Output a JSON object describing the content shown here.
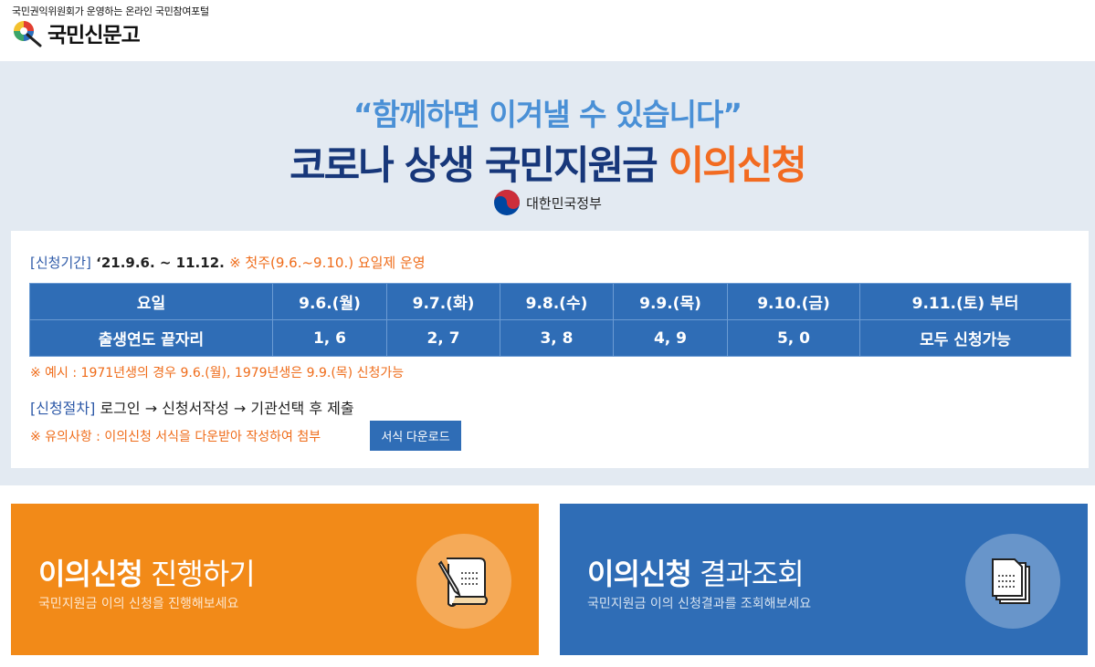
{
  "header": {
    "tagline": "국민권익위원회가 운영하는 온라인 국민참여포털",
    "logo_text": "국민신문고"
  },
  "banner": {
    "slogan": "“함께하면 이겨낼 수 있습니다”",
    "headline_main": "코로나 상생 국민지원금 ",
    "headline_accent": "이의신청",
    "government": "대한민국정부"
  },
  "info": {
    "period_label": "[신청기간]",
    "period_value": " ‘21.9.6. ~ 11.12. ",
    "period_note": "※ 첫주(9.6.~9.10.) 요일제 운영",
    "schedule": {
      "header_row": [
        "요일",
        "9.6.(월)",
        "9.7.(화)",
        "9.8.(수)",
        "9.9.(목)",
        "9.10.(금)",
        "9.11.(토) 부터"
      ],
      "value_row": [
        "출생연도 끝자리",
        "1, 6",
        "2, 7",
        "3, 8",
        "4, 9",
        "5, 0",
        "모두 신청가능"
      ]
    },
    "example": "※ 예시 : 1971년생의 경우 9.6.(월), 1979년생은 9.9.(목) 신청가능",
    "process_label": "[신청절차]",
    "process_value": " 로그인 → 신청서작성 → 기관선택 후 제출",
    "notice": "※ 유의사항 : 이의신청 서식을 다운받아 작성하여 첨부",
    "download_label": "서식 다운로드"
  },
  "cards": {
    "apply": {
      "title_strong": "이의신청",
      "title_rest": " 진행하기",
      "subtitle": "국민지원금 이의 신청을 진행해보세요",
      "icon": "document-pen-icon"
    },
    "result": {
      "title_strong": "이의신청",
      "title_rest": " 결과조회",
      "subtitle": "국민지원금 이의 신청결과를 조회해보세요",
      "icon": "documents-stack-icon"
    }
  },
  "colors": {
    "accent_orange": "#f28a18",
    "accent_blue": "#2f6db6",
    "headline_navy": "#17377a",
    "slogan_blue": "#4a90d6",
    "banner_bg": "#e3eaf2"
  }
}
